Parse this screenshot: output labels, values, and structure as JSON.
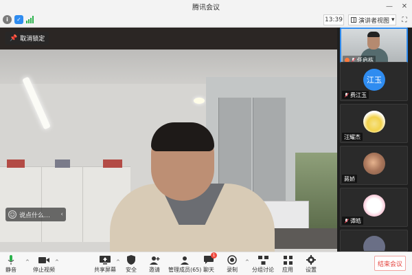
{
  "window": {
    "title": "腾讯会议",
    "minimize": "—",
    "close": "✕"
  },
  "toolbar": {
    "time": "13:39",
    "view_label": "演讲者视图",
    "view_caret": "▾",
    "fullscreen": "⛶",
    "info_icon": "info-icon",
    "shield_icon": "shield-icon",
    "signal_icon": "signal-strength-icon"
  },
  "stage": {
    "unlock_label": "取消锁定",
    "chat_placeholder": "说点什么…",
    "chat_collapse": "‹"
  },
  "participants": [
    {
      "name": "任启栋",
      "avatar_text": "",
      "type": "camera",
      "active": true
    },
    {
      "name": "费江玉",
      "avatar_text": "江玉",
      "type": "avatar",
      "avatar_color": "#2f8cf0"
    },
    {
      "name": "汪耀杰",
      "avatar_text": "",
      "type": "avatar",
      "avatar_color": "#f2d24b"
    },
    {
      "name": "蔣娇",
      "avatar_text": "",
      "type": "avatar",
      "avatar_color": "#c9a37a"
    },
    {
      "name": "谭皓",
      "avatar_text": "",
      "type": "avatar",
      "avatar_color": "#f7c6d6"
    },
    {
      "name": "",
      "avatar_text": "",
      "type": "avatar",
      "avatar_color": "#6a6f86"
    }
  ],
  "controls": {
    "mute": "静音",
    "stop_video": "停止视频",
    "share_screen": "共享屏幕",
    "security": "安全",
    "invite": "邀请",
    "manage_members": "管理成员(65)",
    "chat": "聊天",
    "chat_badge": "1",
    "record": "录制",
    "breakout": "分组讨论",
    "apps": "应用",
    "settings": "设置",
    "end_meeting": "结束会议"
  },
  "colors": {
    "accent": "#2f8cf0",
    "end": "#e3413b",
    "signal": "#2bb24c"
  }
}
